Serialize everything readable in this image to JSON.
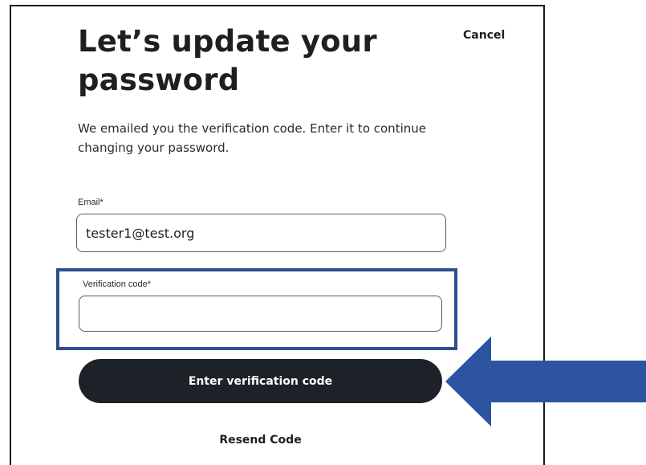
{
  "dialog": {
    "title": "Let’s update your password",
    "cancel_label": "Cancel",
    "description": "We emailed you the verification code. Enter it to continue changing your password."
  },
  "form": {
    "email": {
      "label": "Email*",
      "value": "tester1@test.org"
    },
    "verification_code": {
      "label": "Verification code*",
      "value": ""
    },
    "submit_label": "Enter verification code",
    "resend_label": "Resend Code"
  },
  "annotations": {
    "highlight_color": "#2d4f8e",
    "arrow_color": "#2d54a0",
    "arrow_icon": "arrow-left-icon"
  },
  "colors": {
    "button_bg": "#1d2128",
    "button_text": "#ffffff",
    "text": "#1e1f22"
  }
}
